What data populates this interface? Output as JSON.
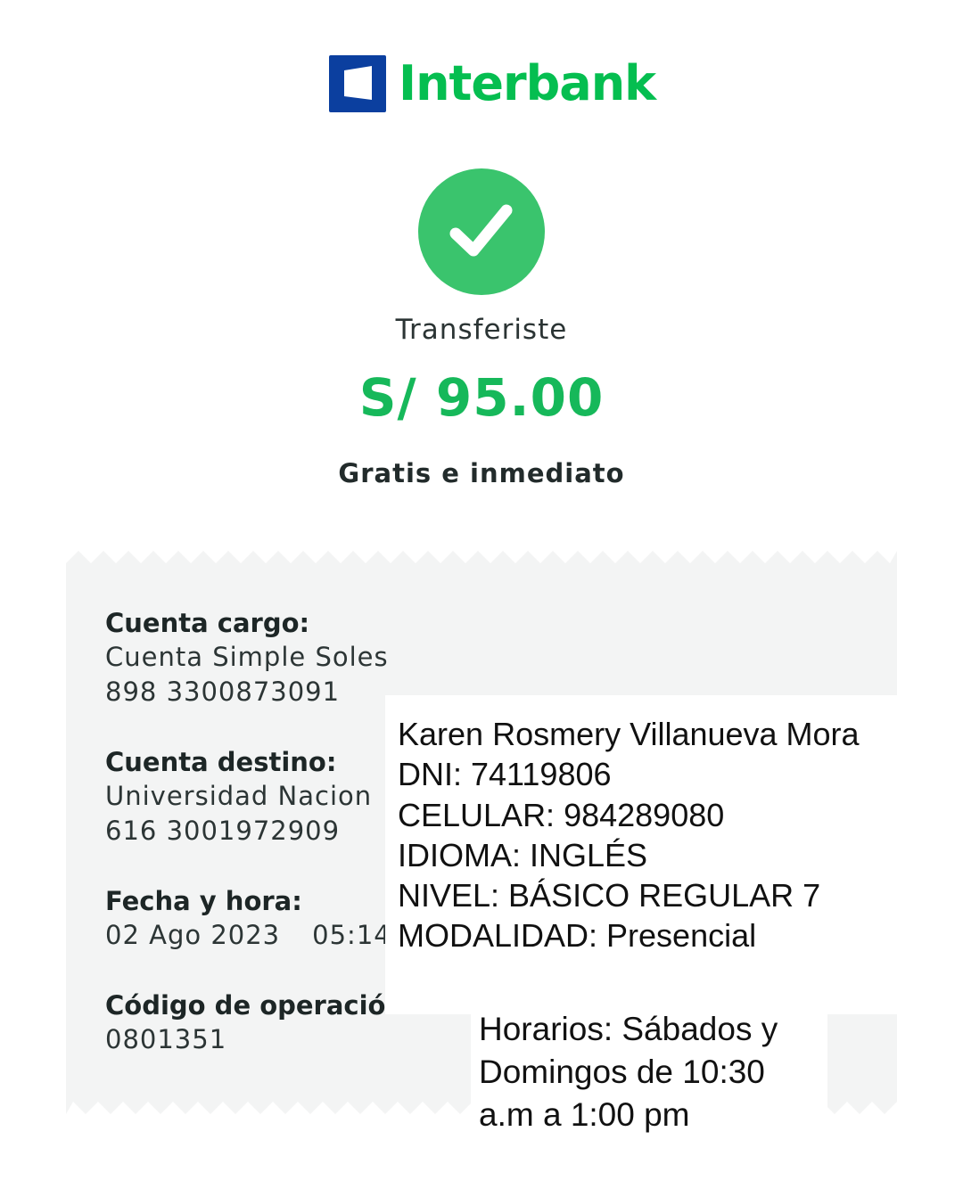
{
  "brand": {
    "name": "Interbank",
    "blue": "#0b3f9f",
    "green": "#05be50"
  },
  "status": {
    "icon": "check-icon",
    "color": "#3ac46d",
    "label": "Transferiste"
  },
  "amount": {
    "text": "S/ 95.00",
    "color": "#16b85a"
  },
  "fee_note": "Gratis e inmediato",
  "receipt": {
    "background": "#f3f4f4",
    "account_charge": {
      "label": "Cuenta cargo:",
      "name": "Cuenta Simple Soles",
      "number": "898 3300873091"
    },
    "account_destination": {
      "label": "Cuenta destino:",
      "name": "Universidad Nacion",
      "number": "616 3001972909"
    },
    "datetime": {
      "label": "Fecha y hora:",
      "date": "02 Ago 2023",
      "time": "05:14"
    },
    "operation": {
      "label": "Código de operació",
      "code": "0801351"
    }
  },
  "note": {
    "lines": [
      "Karen Rosmery Villanueva Mora",
      "DNI: 74119806",
      "CELULAR: 984289080",
      "IDIOMA: INGLÉS",
      "NIVEL: BÁSICO REGULAR 7",
      "MODALIDAD: Presencial"
    ],
    "schedule": "Horarios: Sábados y Domingos de 10:30 a.m a 1:00 pm"
  }
}
